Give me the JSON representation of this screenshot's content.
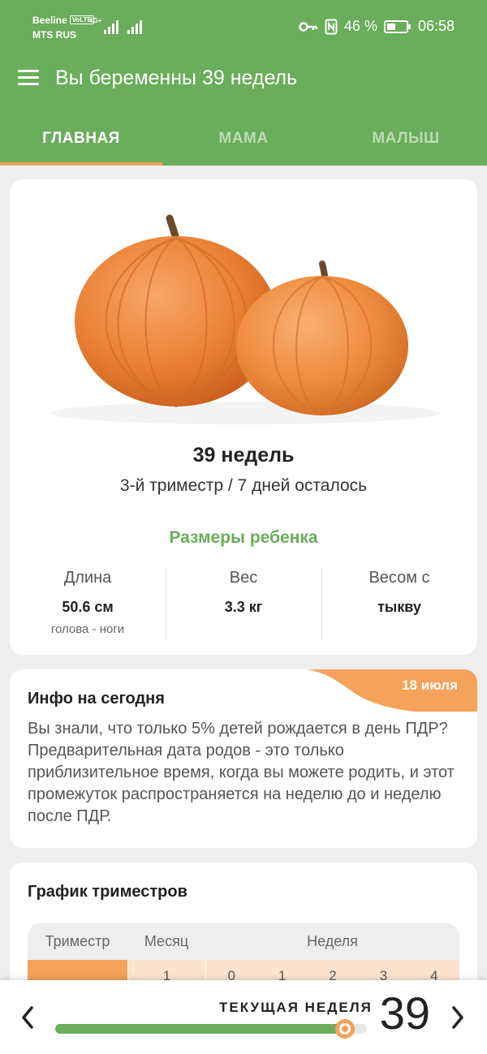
{
  "status_bar": {
    "carrier_1": "Beeline",
    "volte": "VoLTE",
    "carrier_2": "MTS RUS",
    "network": "4G+",
    "battery_percent": "46 %",
    "battery_level": 0.46,
    "time": "06:58",
    "icons": [
      "key-icon",
      "nfc-icon",
      "battery-icon",
      "signal-icon"
    ]
  },
  "app_bar": {
    "title": "Вы беременны 39 недель"
  },
  "tabs": [
    {
      "label": "ГЛАВНАЯ",
      "active": true
    },
    {
      "label": "МАМА",
      "active": false
    },
    {
      "label": "МАЛЫШ",
      "active": false
    }
  ],
  "week_card": {
    "week_title": "39 недель",
    "trimester_line": "3-й триместр / 7 дней осталось",
    "sizes_title": "Размеры ребенка",
    "stats": [
      {
        "label": "Длина",
        "value": "50.6 см",
        "sub": "голова - ноги"
      },
      {
        "label": "Вес",
        "value": "3.3 кг",
        "sub": ""
      },
      {
        "label": "Весом с",
        "value": "тыкву",
        "sub": ""
      }
    ]
  },
  "info_card": {
    "date": "18 июля",
    "title": "Инфо на сегодня",
    "body": "Вы знали, что только 5% детей рождается в день ПДР? Предварительная дата родов - это только приблизительное время, когда вы можете родить, и этот промежуток распространяется на неделю до и неделю после ПДР."
  },
  "schedule_card": {
    "title": "График триместров",
    "headers": {
      "trimester": "Триместр",
      "month": "Месяц",
      "week": "Неделя"
    },
    "row": {
      "month": "1",
      "weeks": [
        "0",
        "1",
        "2",
        "3",
        "4"
      ]
    }
  },
  "bottom_bar": {
    "current_week_label": "ТЕКУЩАЯ НЕДЕЛЯ",
    "current_week": "39",
    "progress": 0.93
  },
  "colors": {
    "primary_green": "#6aad5a",
    "accent_orange": "#f5a25a",
    "light_orange": "#fbe4cf"
  }
}
